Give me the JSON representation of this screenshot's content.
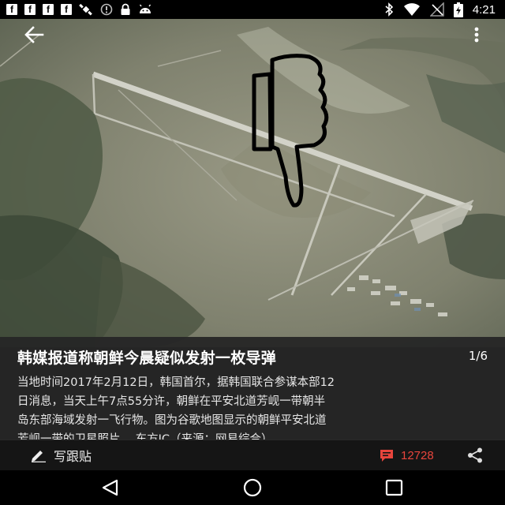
{
  "status_bar": {
    "left_icons": [
      "facebook-icon",
      "facebook-icon",
      "facebook-icon",
      "facebook-icon",
      "satellite-icon",
      "sync-icon",
      "lock-icon",
      "android-icon"
    ],
    "facebook_glyph": "f",
    "right_icons": [
      "bluetooth-icon",
      "wifi-icon",
      "no-signal-icon",
      "battery-charging-icon"
    ],
    "time": "4:21"
  },
  "app_bar": {
    "back_icon": "arrow-left-icon",
    "menu_icon": "more-vertical-icon"
  },
  "photo": {
    "description_icon": "thumbs-down-drawing"
  },
  "caption": {
    "title": "韩媒报道称朝鲜今晨疑似发射一枚导弹",
    "page_indicator": "1/6",
    "body_lines": [
      "当地时间2017年2月12日，韩国首尔，据韩国联合参谋本部12",
      "日消息，当天上午7点55分许，朝鲜在平安北道芳岘一带朝半",
      "岛东部海域发射一飞行物。图为谷歌地图显示的朝鲜平安北道",
      "芳岘一带的卫星照片。  东方IC（来源：网易综合）"
    ]
  },
  "action_bar": {
    "follow_label": "写跟贴",
    "follow_icon": "pencil-icon",
    "comment_icon": "comment-icon",
    "comment_count": "12728",
    "share_icon": "share-icon",
    "accent_color": "#e8453c"
  },
  "nav_bar": {
    "back": "triangle-back-icon",
    "home": "circle-home-icon",
    "recents": "square-recents-icon"
  }
}
